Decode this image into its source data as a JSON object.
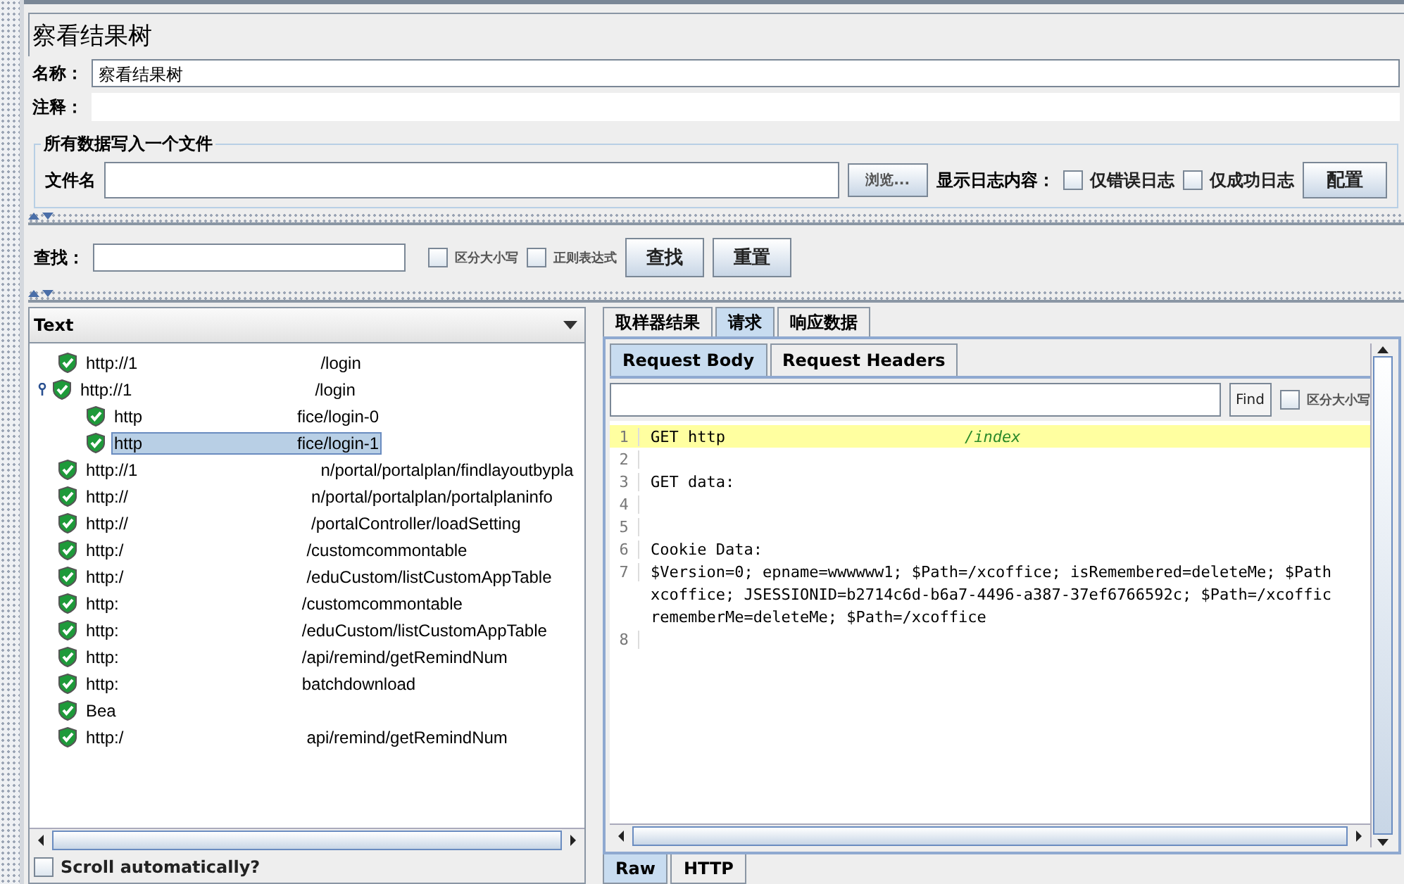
{
  "title": "察看结果树",
  "name_field": {
    "label": "名称：",
    "value": "察看结果树"
  },
  "comment_field": {
    "label": "注释："
  },
  "file_group": {
    "legend": "所有数据写入一个文件",
    "label": "文件名",
    "browse": "浏览...",
    "log_label": "显示日志内容：",
    "options": [
      {
        "label": "仅错误日志",
        "checked": false
      },
      {
        "label": "仅成功日志",
        "checked": false
      }
    ],
    "config": "配置"
  },
  "search": {
    "label": "查找：",
    "options": [
      {
        "label": "区分大小写",
        "checked": false
      },
      {
        "label": "正则表达式",
        "checked": false
      }
    ],
    "buttons": [
      "查找",
      "重置"
    ]
  },
  "renderer": {
    "value": "Text"
  },
  "tree": [
    {
      "prefix": "http://1",
      "suffix": "/login",
      "selected": false,
      "expanded": false
    },
    {
      "prefix": "http://1",
      "suffix": "/login",
      "selected": false,
      "expanded": true,
      "children": [
        {
          "prefix": "http",
          "suffix": "fice/login-0",
          "selected": false,
          "expanded": false
        },
        {
          "prefix": "http",
          "suffix": "fice/login-1",
          "selected": true,
          "expanded": false
        }
      ]
    },
    {
      "prefix": "http://1",
      "suffix": "n/portal/portalplan/findlayoutbypla",
      "selected": false,
      "expanded": false
    },
    {
      "prefix": "http://",
      "suffix": "n/portal/portalplan/portalplaninfo",
      "selected": false,
      "expanded": false
    },
    {
      "prefix": "http://",
      "suffix": "/portalController/loadSetting",
      "selected": false,
      "expanded": false
    },
    {
      "prefix": "http:/",
      "suffix": "/customcommontable",
      "selected": false,
      "expanded": false
    },
    {
      "prefix": "http:/",
      "suffix": "/eduCustom/listCustomAppTable",
      "selected": false,
      "expanded": false
    },
    {
      "prefix": "http:",
      "suffix": "/customcommontable",
      "selected": false,
      "expanded": false
    },
    {
      "prefix": "http:",
      "suffix": "/eduCustom/listCustomAppTable",
      "selected": false,
      "expanded": false
    },
    {
      "prefix": "http:",
      "suffix": "/api/remind/getRemindNum",
      "selected": false,
      "expanded": false
    },
    {
      "prefix": "http:",
      "suffix": "batchdownload",
      "selected": false,
      "expanded": false
    },
    {
      "prefix": "Bea",
      "selected": false,
      "expanded": false
    },
    {
      "prefix": "http:/",
      "suffix": "api/remind/getRemindNum",
      "selected": false,
      "expanded": false
    }
  ],
  "scroll_auto": {
    "label": "Scroll automatically?",
    "checked": false
  },
  "result_tabs": [
    {
      "label": "取样器结果",
      "selected": false
    },
    {
      "label": "请求",
      "selected": true
    },
    {
      "label": "响应数据",
      "selected": false
    }
  ],
  "request_tabs": [
    {
      "label": "Request Body",
      "selected": true
    },
    {
      "label": "Request Headers",
      "selected": false
    }
  ],
  "find": {
    "button": "Find",
    "option": {
      "label": "区分大小写",
      "checked": false
    }
  },
  "code_lines": [
    {
      "number": "1",
      "highlighted": true,
      "parts": [
        {
          "kind": "plain",
          "text": "GET http"
        },
        {
          "kind": "path",
          "text": "/index"
        }
      ]
    },
    {
      "number": "2",
      "highlighted": false
    },
    {
      "number": "3",
      "highlighted": false,
      "parts": [
        {
          "kind": "plain",
          "text": "GET data:"
        }
      ]
    },
    {
      "number": "4",
      "highlighted": false
    },
    {
      "number": "5",
      "highlighted": false
    },
    {
      "number": "6",
      "highlighted": false,
      "parts": [
        {
          "kind": "plain",
          "text": "Cookie Data:"
        }
      ]
    },
    {
      "number": "7",
      "highlighted": false,
      "parts": [
        {
          "kind": "plain",
          "text": "$Version=0; epname=wwwwww1; $Path=/xcoffice; isRemembered=deleteMe; $Path"
        }
      ],
      "wrapped": [
        "xcoffice; JSESSIONID=b2714c6d-b6a7-4496-a387-37ef6766592c; $Path=/xcoffic",
        "rememberMe=deleteMe; $Path=/xcoffice"
      ]
    },
    {
      "number": "8",
      "highlighted": false
    }
  ],
  "view_tabs": [
    {
      "label": "Raw",
      "selected": true
    },
    {
      "label": "HTTP",
      "selected": false
    }
  ]
}
